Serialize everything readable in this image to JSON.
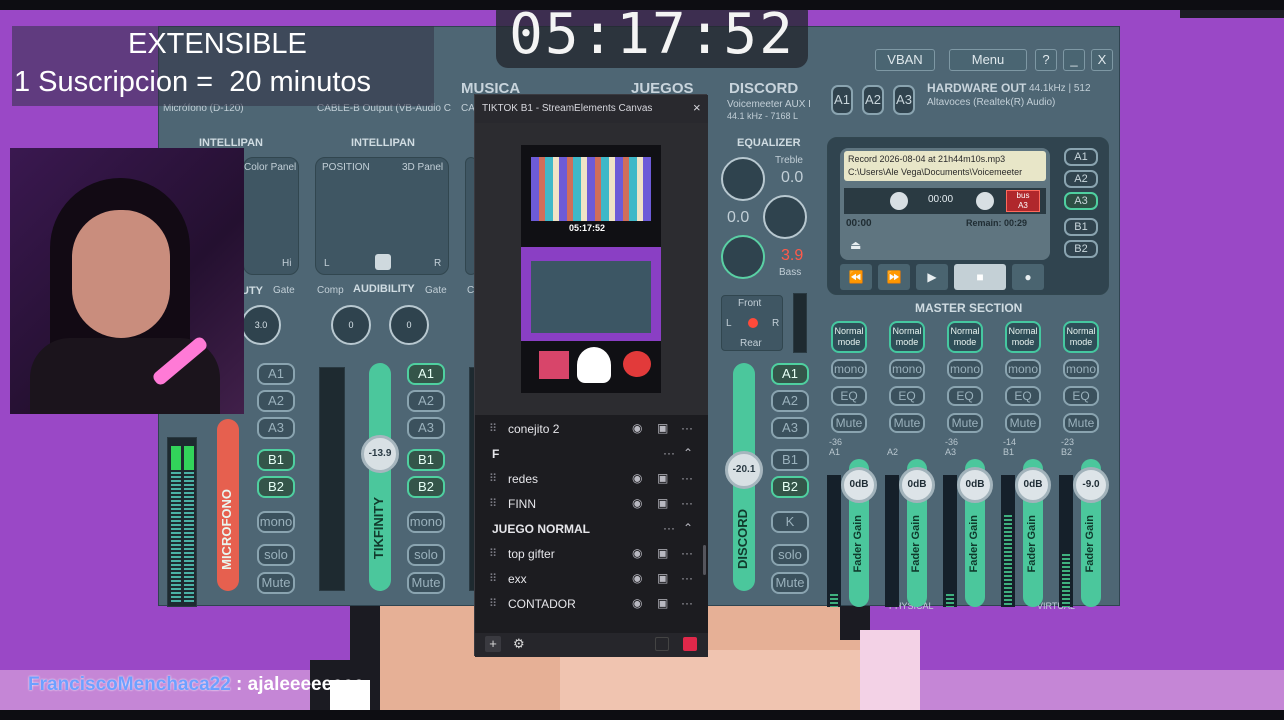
{
  "overlay": {
    "headline_1": "EXTENSIBLE",
    "headline_2": "1 Suscripcion =  20 minutos",
    "timer": "05:17:52",
    "chat_user": "FranciscoMenchaca22",
    "chat_sep": " : ",
    "chat_message": "ajaleeeeeeee"
  },
  "voicemeeter": {
    "buttons": {
      "vban": "VBAN",
      "menu": "Menu",
      "help": "?",
      "minimize": "_",
      "close": "X"
    },
    "strips": {
      "musica": "MUSICA",
      "juegos": "JUEGOS",
      "discord": "DISCORD",
      "discord_sub_1": "Voicemeeter AUX I",
      "discord_sub_2": "44.1 kHz - 7168 L",
      "cable_sub": "CABLE-B Output (VB-Audio C",
      "mic_sub": "Micrófono (D-120)"
    },
    "hardware_out": {
      "a1": "A1",
      "a2": "A2",
      "a3": "A3",
      "title": "HARDWARE OUT",
      "rate": "44.1kHz | 512",
      "device": "Altavoces (Realtek(R) Audio)"
    },
    "intellipan_1": {
      "title": "INTELLIPAN",
      "color_panel": "Color Panel",
      "hi": "Hi"
    },
    "intellipan_2": {
      "title": "INTELLIPAN",
      "position": "POSITION",
      "panel": "3D Panel",
      "l": "L",
      "r": "R"
    },
    "strip1": {
      "partial_label": "UTY",
      "gate": "Gate",
      "knob": "3.0",
      "label": "MICROFONO",
      "a1": "A1",
      "a2": "A2",
      "a3": "A3",
      "b1": "B1",
      "b2": "B2",
      "mono": "mono",
      "solo": "solo",
      "mute": "Mute"
    },
    "strip2": {
      "comp": "Comp",
      "aud": "AUDIBILITY",
      "gate": "Gate",
      "k1": "0",
      "k2": "0",
      "fader": "-13.9",
      "label": "TIKFINITY",
      "a1": "A1",
      "a2": "A2",
      "a3": "A3",
      "b1": "B1",
      "b2": "B2",
      "mono": "mono",
      "solo": "solo",
      "mute": "Mute"
    },
    "strip_partial": {
      "comp": "C"
    },
    "discord_strip": {
      "eq": "EQUALIZER",
      "treble": "Treble",
      "treble_val": "0.0",
      "mid_val": "0.0",
      "bass_val": "3.9",
      "bass": "Bass",
      "front": "Front",
      "rear": "Rear",
      "l": "L",
      "r": "R",
      "fader": "-20.1",
      "label": "DISCORD",
      "a1": "A1",
      "a2": "A2",
      "a3": "A3",
      "b1": "B1",
      "b2": "B2",
      "k": "K",
      "solo": "solo",
      "mute": "Mute"
    },
    "recorder": {
      "file": "Record 2026-08-04 at 21h44m10s.mp3",
      "path": "C:\\Users\\Ale Vega\\Documents\\Voicemeeter",
      "counter": "00:00",
      "bus": "bus",
      "bus_target": "A3",
      "time": "00:00",
      "remain": "Remain: 00:29",
      "a1": "A1",
      "a2": "A2",
      "a3": "A3",
      "b1": "B1",
      "b2": "B2"
    },
    "master": {
      "title": "MASTER SECTION",
      "physical": "PHYSICAL",
      "virtual": "VIRTUAL",
      "channels": [
        {
          "mode": "Normal mode",
          "mono": "mono",
          "eq": "EQ",
          "mute": "Mute",
          "lvl": "-36",
          "name": "A1",
          "gain": "0dB",
          "label": "Fader Gain",
          "fill": 0.1
        },
        {
          "mode": "Normal mode",
          "mono": "mono",
          "eq": "EQ",
          "mute": "Mute",
          "lvl": "",
          "name": "A2",
          "gain": "0dB",
          "label": "Fader Gain",
          "fill": 0.0
        },
        {
          "mode": "Normal mode",
          "mono": "mono",
          "eq": "EQ",
          "mute": "Mute",
          "lvl": "-36",
          "name": "A3",
          "gain": "0dB",
          "label": "Fader Gain",
          "fill": 0.1
        },
        {
          "mode": "Normal mode",
          "mono": "mono",
          "eq": "EQ",
          "mute": "Mute",
          "lvl": "-14",
          "name": "B1",
          "gain": "0dB",
          "label": "Fader Gain",
          "fill": 0.7
        },
        {
          "mode": "Normal mode",
          "mono": "mono",
          "eq": "EQ",
          "mute": "Mute",
          "lvl": "-23",
          "name": "B2",
          "gain": "-9.0",
          "label": "Fader Gain",
          "fill": 0.4
        }
      ]
    }
  },
  "tiktok_window": {
    "title": "TIKTOK B1 - StreamElements Canvas",
    "close": "×",
    "preview_timer": "05:17:52",
    "sources": [
      {
        "name": "conejito 2",
        "type": "item"
      },
      {
        "name": "F",
        "type": "group"
      },
      {
        "name": "redes",
        "type": "item"
      },
      {
        "name": "FINN",
        "type": "item"
      },
      {
        "name": "JUEGO NORMAL",
        "type": "group"
      },
      {
        "name": "top gifter",
        "type": "item"
      },
      {
        "name": "exx",
        "type": "item"
      },
      {
        "name": "CONTADOR",
        "type": "item"
      }
    ],
    "add": "+",
    "settings": "⚙"
  },
  "colors": {
    "accent_green": "#4bc79c",
    "mic_red": "#e6604f",
    "background_purple": "#9a48c6",
    "chat_user": "#6ea0ff"
  }
}
